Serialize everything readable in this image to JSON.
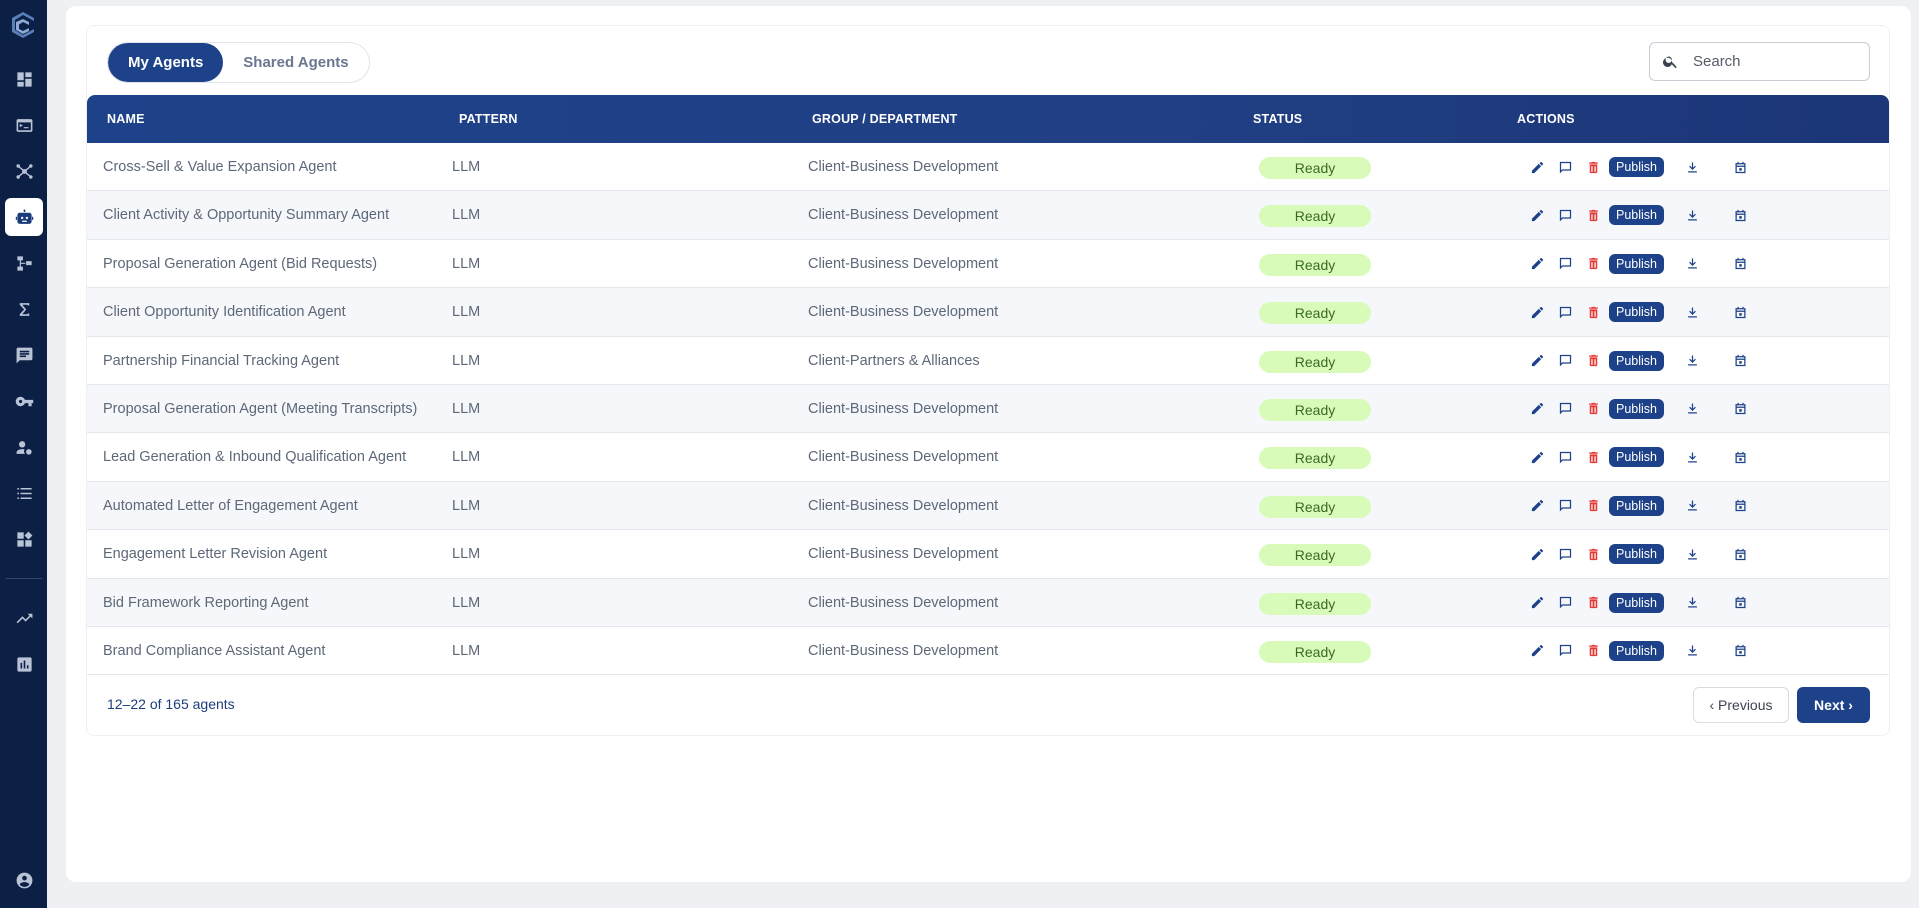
{
  "tabs": [
    {
      "label": "My Agents",
      "active": true
    },
    {
      "label": "Shared Agents",
      "active": false
    }
  ],
  "search": {
    "placeholder": "Search",
    "value": ""
  },
  "table": {
    "columns": [
      "NAME",
      "PATTERN",
      "GROUP / DEPARTMENT",
      "STATUS",
      "ACTIONS"
    ],
    "publish_label": "Publish",
    "rows": [
      {
        "name": "Cross-Sell & Value Expansion Agent",
        "pattern": "LLM",
        "group": "Client-Business Development",
        "status": "Ready"
      },
      {
        "name": "Client Activity & Opportunity Summary Agent",
        "pattern": "LLM",
        "group": "Client-Business Development",
        "status": "Ready"
      },
      {
        "name": "Proposal Generation Agent (Bid Requests)",
        "pattern": "LLM",
        "group": "Client-Business Development",
        "status": "Ready"
      },
      {
        "name": "Client Opportunity Identification Agent",
        "pattern": "LLM",
        "group": "Client-Business Development",
        "status": "Ready"
      },
      {
        "name": "Partnership Financial Tracking Agent",
        "pattern": "LLM",
        "group": "Client-Partners & Alliances",
        "status": "Ready"
      },
      {
        "name": "Proposal Generation Agent (Meeting Transcripts)",
        "pattern": "LLM",
        "group": "Client-Business Development",
        "status": "Ready"
      },
      {
        "name": "Lead Generation & Inbound Qualification Agent",
        "pattern": "LLM",
        "group": "Client-Business Development",
        "status": "Ready"
      },
      {
        "name": "Automated Letter of Engagement Agent",
        "pattern": "LLM",
        "group": "Client-Business Development",
        "status": "Ready"
      },
      {
        "name": "Engagement Letter Revision Agent",
        "pattern": "LLM",
        "group": "Client-Business Development",
        "status": "Ready"
      },
      {
        "name": "Bid Framework Reporting Agent",
        "pattern": "LLM",
        "group": "Client-Business Development",
        "status": "Ready"
      },
      {
        "name": "Brand Compliance Assistant Agent",
        "pattern": "LLM",
        "group": "Client-Business Development",
        "status": "Ready"
      }
    ]
  },
  "pagination": {
    "summary": "12–22 of 165 agents",
    "prev_label": "‹ Previous",
    "next_label": "Next ›"
  },
  "colors": {
    "sidebar": "#0c1f45",
    "accent": "#1d4289",
    "ready_bg": "#d9fbb9",
    "delete": "#e53935"
  },
  "sidebar": {
    "items": [
      {
        "icon": "dashboard-icon"
      },
      {
        "icon": "terminal-icon"
      },
      {
        "icon": "network-icon"
      },
      {
        "icon": "robot-icon",
        "active": true
      },
      {
        "icon": "workflow-icon"
      },
      {
        "icon": "sigma-icon"
      },
      {
        "icon": "chat-icon"
      },
      {
        "icon": "key-icon"
      },
      {
        "icon": "user-settings-icon"
      },
      {
        "icon": "list-icon"
      },
      {
        "icon": "widgets-icon"
      },
      {
        "icon": "trending-icon"
      },
      {
        "icon": "bar-chart-icon"
      },
      {
        "icon": "account-icon"
      }
    ]
  }
}
